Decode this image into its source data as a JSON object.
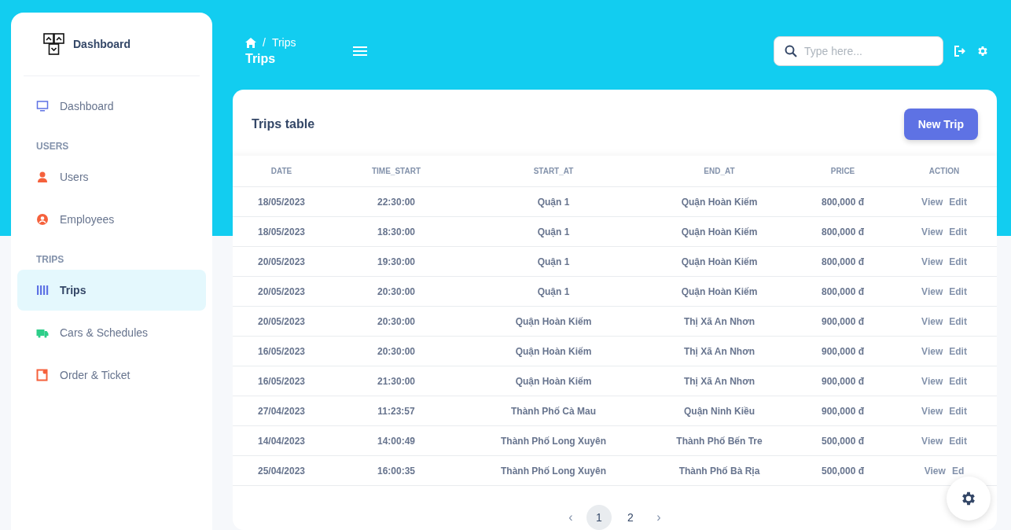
{
  "sidebar": {
    "brand": "Dashboard",
    "items": [
      {
        "kind": "link",
        "label": "Dashboard",
        "selected": false
      },
      {
        "kind": "heading",
        "label": "USERS"
      },
      {
        "kind": "link",
        "label": "Users",
        "selected": false
      },
      {
        "kind": "link",
        "label": "Employees",
        "selected": false
      },
      {
        "kind": "heading",
        "label": "TRIPS"
      },
      {
        "kind": "link",
        "label": "Trips",
        "selected": true
      },
      {
        "kind": "link",
        "label": "Cars & Schedules",
        "selected": false
      },
      {
        "kind": "link",
        "label": "Order & Ticket",
        "selected": false
      }
    ]
  },
  "header": {
    "breadcrumb": [
      "Trips"
    ],
    "separator": "/",
    "title": "Trips",
    "search": {
      "placeholder": "Type here..."
    }
  },
  "card": {
    "title": "Trips table",
    "button": "New Trip"
  },
  "table": {
    "columns": [
      "DATE",
      "TIME_START",
      "START_AT",
      "END_AT",
      "PRICE",
      "ACTION"
    ],
    "rows": [
      {
        "cells": [
          "18/05/2023",
          "22:30:00",
          "Quận 1",
          "Quận Hoàn Kiếm",
          "800,000 đ"
        ],
        "actions": [
          "View",
          "Edit"
        ]
      },
      {
        "cells": [
          "18/05/2023",
          "18:30:00",
          "Quận 1",
          "Quận Hoàn Kiếm",
          "800,000 đ"
        ],
        "actions": [
          "View",
          "Edit"
        ]
      },
      {
        "cells": [
          "20/05/2023",
          "19:30:00",
          "Quận 1",
          "Quận Hoàn Kiếm",
          "800,000 đ"
        ],
        "actions": [
          "View",
          "Edit"
        ]
      },
      {
        "cells": [
          "20/05/2023",
          "20:30:00",
          "Quận 1",
          "Quận Hoàn Kiếm",
          "800,000 đ"
        ],
        "actions": [
          "View",
          "Edit"
        ]
      },
      {
        "cells": [
          "20/05/2023",
          "20:30:00",
          "Quận Hoàn Kiếm",
          "Thị Xã An Nhơn",
          "900,000 đ"
        ],
        "actions": [
          "View",
          "Edit"
        ]
      },
      {
        "cells": [
          "16/05/2023",
          "20:30:00",
          "Quận Hoàn Kiếm",
          "Thị Xã An Nhơn",
          "900,000 đ"
        ],
        "actions": [
          "View",
          "Edit"
        ]
      },
      {
        "cells": [
          "16/05/2023",
          "21:30:00",
          "Quận Hoàn Kiếm",
          "Thị Xã An Nhơn",
          "900,000 đ"
        ],
        "actions": [
          "View",
          "Edit"
        ]
      },
      {
        "cells": [
          "27/04/2023",
          "11:23:57",
          "Thành Phố Cà Mau",
          "Quận Ninh Kiều",
          "900,000 đ"
        ],
        "actions": [
          "View",
          "Edit"
        ]
      },
      {
        "cells": [
          "14/04/2023",
          "14:00:49",
          "Thành Phố Long Xuyên",
          "Thành Phố Bến Tre",
          "500,000 đ"
        ],
        "actions": [
          "View",
          "Edit"
        ]
      },
      {
        "cells": [
          "25/04/2023",
          "16:00:35",
          "Thành Phố Long Xuyên",
          "Thành Phố Bà Rịa",
          "500,000 đ"
        ],
        "actions": [
          "View",
          "Ed"
        ]
      }
    ]
  },
  "pagination": {
    "prev": "‹",
    "next": "›",
    "pages": [
      {
        "label": "1",
        "selected": true
      },
      {
        "label": "2",
        "selected": false
      }
    ]
  }
}
